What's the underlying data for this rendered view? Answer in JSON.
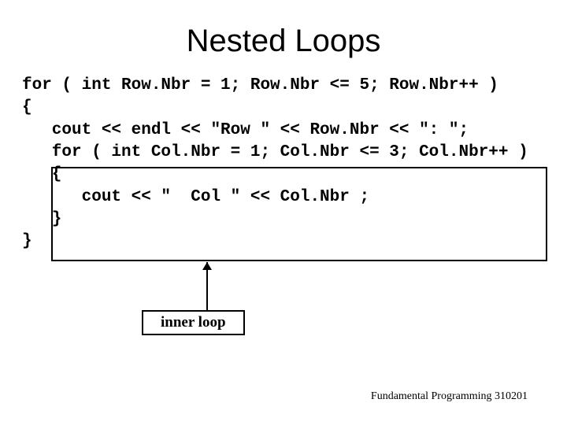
{
  "title": "Nested Loops",
  "code": {
    "l1": "for ( int Row.Nbr = 1; Row.Nbr <= 5; Row.Nbr++ )",
    "l2": "{",
    "l3": "   cout << endl << \"Row \" << Row.Nbr << \": \";",
    "l4": "   for ( int Col.Nbr = 1; Col.Nbr <= 3; Col.Nbr++ )",
    "l5": "   {",
    "l6": "      cout << \"  Col \" << Col.Nbr ;",
    "l7": "   }",
    "l8": "}"
  },
  "label": "inner loop",
  "footer": "Fundamental Programming 310201"
}
